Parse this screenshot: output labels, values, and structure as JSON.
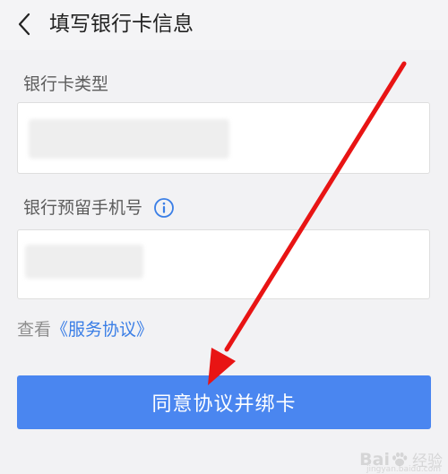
{
  "header": {
    "title": "填写银行卡信息",
    "back_icon": "chevron-left-icon"
  },
  "form": {
    "card_type_label": "银行卡类型",
    "phone_label": "银行预留手机号",
    "phone_info_icon": "info-icon"
  },
  "agreement": {
    "prefix": "查看",
    "link_text": "《服务协议》"
  },
  "submit": {
    "label": "同意协议并绑卡"
  },
  "watermark": {
    "logo_text_left": "Bai",
    "logo_text_right": "经验",
    "url": "jingyan.baidu.com"
  },
  "colors": {
    "accent": "#4a86f0",
    "link": "#3a7ee6",
    "annotation_arrow": "#e81414",
    "background": "#f2f2f4"
  }
}
